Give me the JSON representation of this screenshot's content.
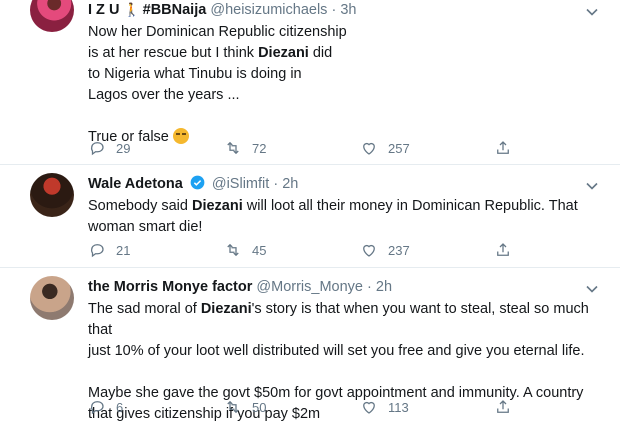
{
  "tweets": [
    {
      "name": "I Z U",
      "name_suffix": "#BBNaija",
      "handle": "@heisizumichaels",
      "time": "3h",
      "lines": [
        "Now her Dominican Republic citizenship",
        "is at her rescue but I think ",
        "Diezani",
        " did",
        "to Nigeria what Tinubu is doing in",
        "Lagos over the years ...",
        "True or false"
      ],
      "replies": "29",
      "retweets": "72",
      "likes": "257"
    },
    {
      "name": "Wale Adetona",
      "handle": "@iSlimfit",
      "time": "2h",
      "text_before": "Somebody said ",
      "highlight": "Diezani",
      "text_after": " will loot all their money in Dominican Republic. That",
      "line2": "woman smart die!",
      "replies": "21",
      "retweets": "45",
      "likes": "237"
    },
    {
      "name": "the Morris Monye factor",
      "handle": "@Morris_Monye",
      "time": "2h",
      "text_before": "The sad moral of ",
      "highlight": "Diezani",
      "text_after": "'s story is that when you want to steal, steal so much that",
      "line2": "just 10% of your loot well distributed will set you free and give you eternal life.",
      "para2_line1": "Maybe she gave the govt $50m for govt appointment and immunity. A country",
      "para2_line2": "that gives citizenship if you pay $2m",
      "replies": "6",
      "retweets": "50",
      "likes": "113"
    }
  ],
  "separator": "·",
  "colors": {
    "text": "#14171a",
    "muted": "#657786",
    "verified": "#1da1f2",
    "divider": "#e6ecf0"
  },
  "icons": [
    "reply-icon",
    "retweet-icon",
    "like-icon",
    "share-icon",
    "chevron-down-icon",
    "verified-icon"
  ]
}
